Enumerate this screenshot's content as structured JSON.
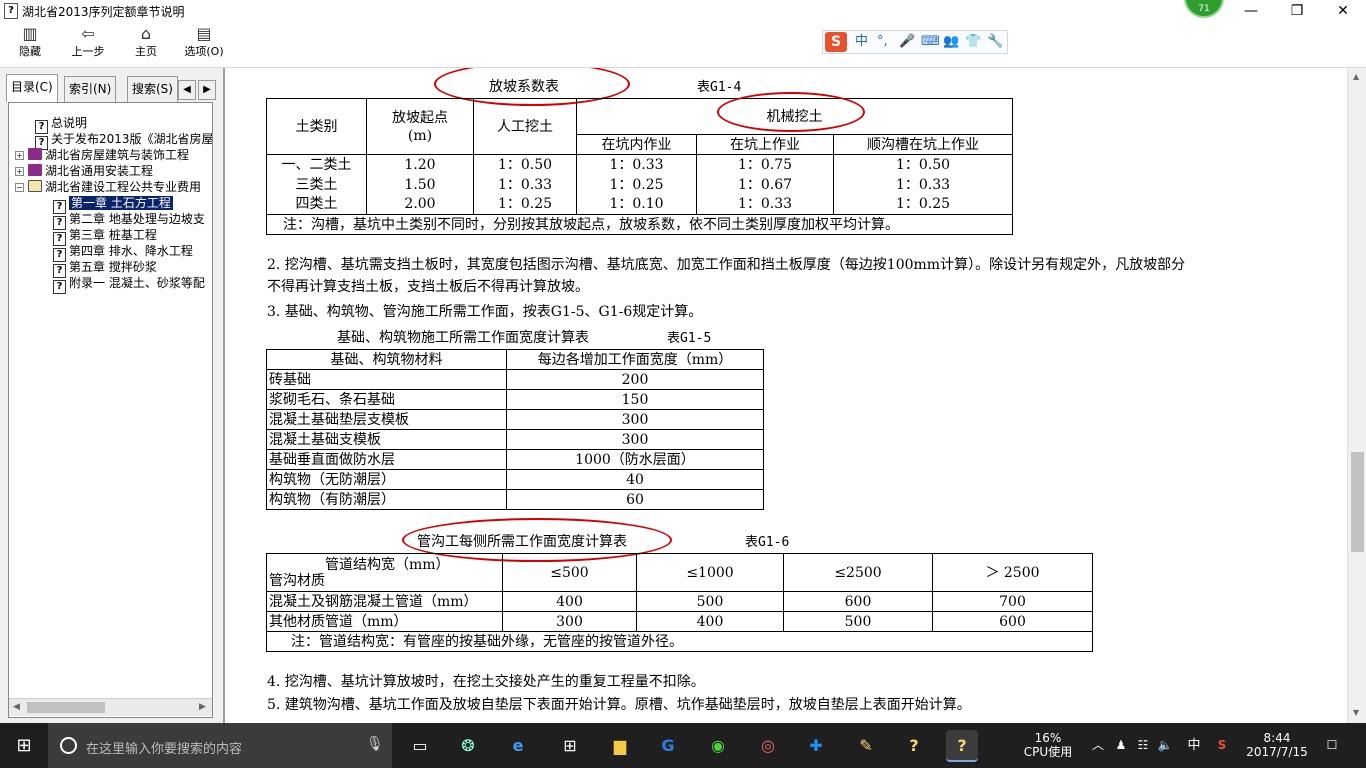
{
  "window": {
    "title": "湖北省2013序列定额章节说明",
    "badge": "71",
    "minimize": "—",
    "restore": "❐",
    "close": "✕"
  },
  "toolbar": {
    "buttons": [
      {
        "label": "隐藏",
        "icon": "hide-icon"
      },
      {
        "label": "上一步",
        "icon": "back-arrow-icon"
      },
      {
        "label": "主页",
        "icon": "home-icon"
      },
      {
        "label": "选项(O)",
        "icon": "options-icon"
      }
    ],
    "ime": {
      "logo": "S",
      "items": [
        "中",
        "°,",
        "🎤",
        "⌨",
        "👥",
        "👕",
        "🔧"
      ]
    }
  },
  "sidebar": {
    "tabs": [
      "目录(C)",
      "索引(N)",
      "搜索(S)"
    ],
    "tree": [
      {
        "label": "总说明",
        "type": "doc",
        "level": 1
      },
      {
        "label": "关于发布2013版《湖北省房屋",
        "type": "doc",
        "level": 1
      },
      {
        "label": "湖北省房屋建筑与装饰工程",
        "type": "book",
        "level": 0,
        "expander": "+"
      },
      {
        "label": "湖北省通用安装工程",
        "type": "book",
        "level": 0,
        "expander": "+"
      },
      {
        "label": "湖北省建设工程公共专业费用",
        "type": "book-open",
        "level": 0,
        "expander": "−"
      },
      {
        "label": "第一章 土石方工程",
        "type": "doc",
        "level": 2,
        "selected": true
      },
      {
        "label": "第二章 地基处理与边坡支",
        "type": "doc",
        "level": 2
      },
      {
        "label": "第三章 桩基工程",
        "type": "doc",
        "level": 2
      },
      {
        "label": "第四章 排水、降水工程",
        "type": "doc",
        "level": 2
      },
      {
        "label": "第五章 搅拌砂浆",
        "type": "doc",
        "level": 2
      },
      {
        "label": "附录一 混凝土、砂浆等配",
        "type": "doc",
        "level": 2
      }
    ]
  },
  "content": {
    "g14": {
      "title": "放坡系数表",
      "code": "表G1-4",
      "h_soil": "土类别",
      "h_start": "放坡起点",
      "h_start_unit": "(m)",
      "h_manual": "人工挖土",
      "h_mech": "机械挖土",
      "h_in_pit": "在坑内作业",
      "h_on_pit": "在坑上作业",
      "h_along": "顺沟槽在坑上作业",
      "rows": [
        [
          "一、二类土",
          "1.20",
          "1：0.50",
          "1：0.33",
          "1：0.75",
          "1：0.50"
        ],
        [
          "三类土",
          "1.50",
          "1：0.33",
          "1：0.25",
          "1：0.67",
          "1：0.33"
        ],
        [
          "四类土",
          "2.00",
          "1：0.25",
          "1：0.10",
          "1：0.33",
          "1：0.25"
        ]
      ],
      "note": "注：沟槽，基坑中土类别不同时，分别按其放坡起点，放坡系数，依不同土类别厚度加权平均计算。"
    },
    "para2_line1": "2. 挖沟槽、基坑需支挡土板时，其宽度包括图示沟槽、基坑底宽、加宽工作面和挡土板厚度（每边按100mm计算）。除设计另有规定外，凡放坡部分",
    "para2_line2": "不得再计算支挡土板，支挡土板后不得再计算放坡。",
    "para3": "3. 基础、构筑物、管沟施工所需工作面，按表G1-5、G1-6规定计算。",
    "g15": {
      "title": "基础、构筑物施工所需工作面宽度计算表",
      "code": "表G1-5",
      "h_material": "基础、构筑物材料",
      "h_width": "每边各增加工作面宽度（mm）",
      "rows": [
        [
          "砖基础",
          "200"
        ],
        [
          "浆砌毛石、条石基础",
          "150"
        ],
        [
          "混凝土基础垫层支模板",
          "300"
        ],
        [
          "混凝土基础支模板",
          "300"
        ],
        [
          "基础垂直面做防水层",
          "1000（防水层面）"
        ],
        [
          "构筑物（无防潮层）",
          "40"
        ],
        [
          "构筑物（有防潮层）",
          "60"
        ]
      ]
    },
    "g16": {
      "title": "管沟工每侧所需工作面宽度计算表",
      "code": "表G1-6",
      "h_diag_top": "管道结构宽（mm）",
      "h_diag_bottom": "管沟材质",
      "cols": [
        "≤500",
        "≤1000",
        "≤2500",
        "＞ 2500"
      ],
      "rows": [
        [
          "混凝土及钢筋混凝土管道（mm）",
          "400",
          "500",
          "600",
          "700"
        ],
        [
          "其他材质管道（mm）",
          "300",
          "400",
          "500",
          "600"
        ]
      ],
      "note": "注：管道结构宽：有管座的按基础外缘，无管座的按管道外径。"
    },
    "para4": "4. 挖沟槽、基坑计算放坡时，在挖土交接处产生的重复工程量不扣除。",
    "para5": "5. 建筑物沟槽、基坑工作面及放坡自垫层下表面开始计算。原槽、坑作基础垫层时，放坡自垫层上表面开始计算。"
  },
  "taskbar": {
    "search_placeholder": "在这里输入你要搜索的内容",
    "apps": [
      "cortana-icon",
      "edge-icon",
      "store-icon",
      "explorer-icon",
      "sogou-icon",
      "360-icon",
      "browser-icon",
      "plus-app-icon",
      "notes-icon",
      "help-icon",
      "help-active-icon"
    ],
    "cpu_pct": "16%",
    "cpu_label": "CPU使用",
    "ime_lang": "中",
    "time": "8:44",
    "date": "2017/7/15"
  }
}
